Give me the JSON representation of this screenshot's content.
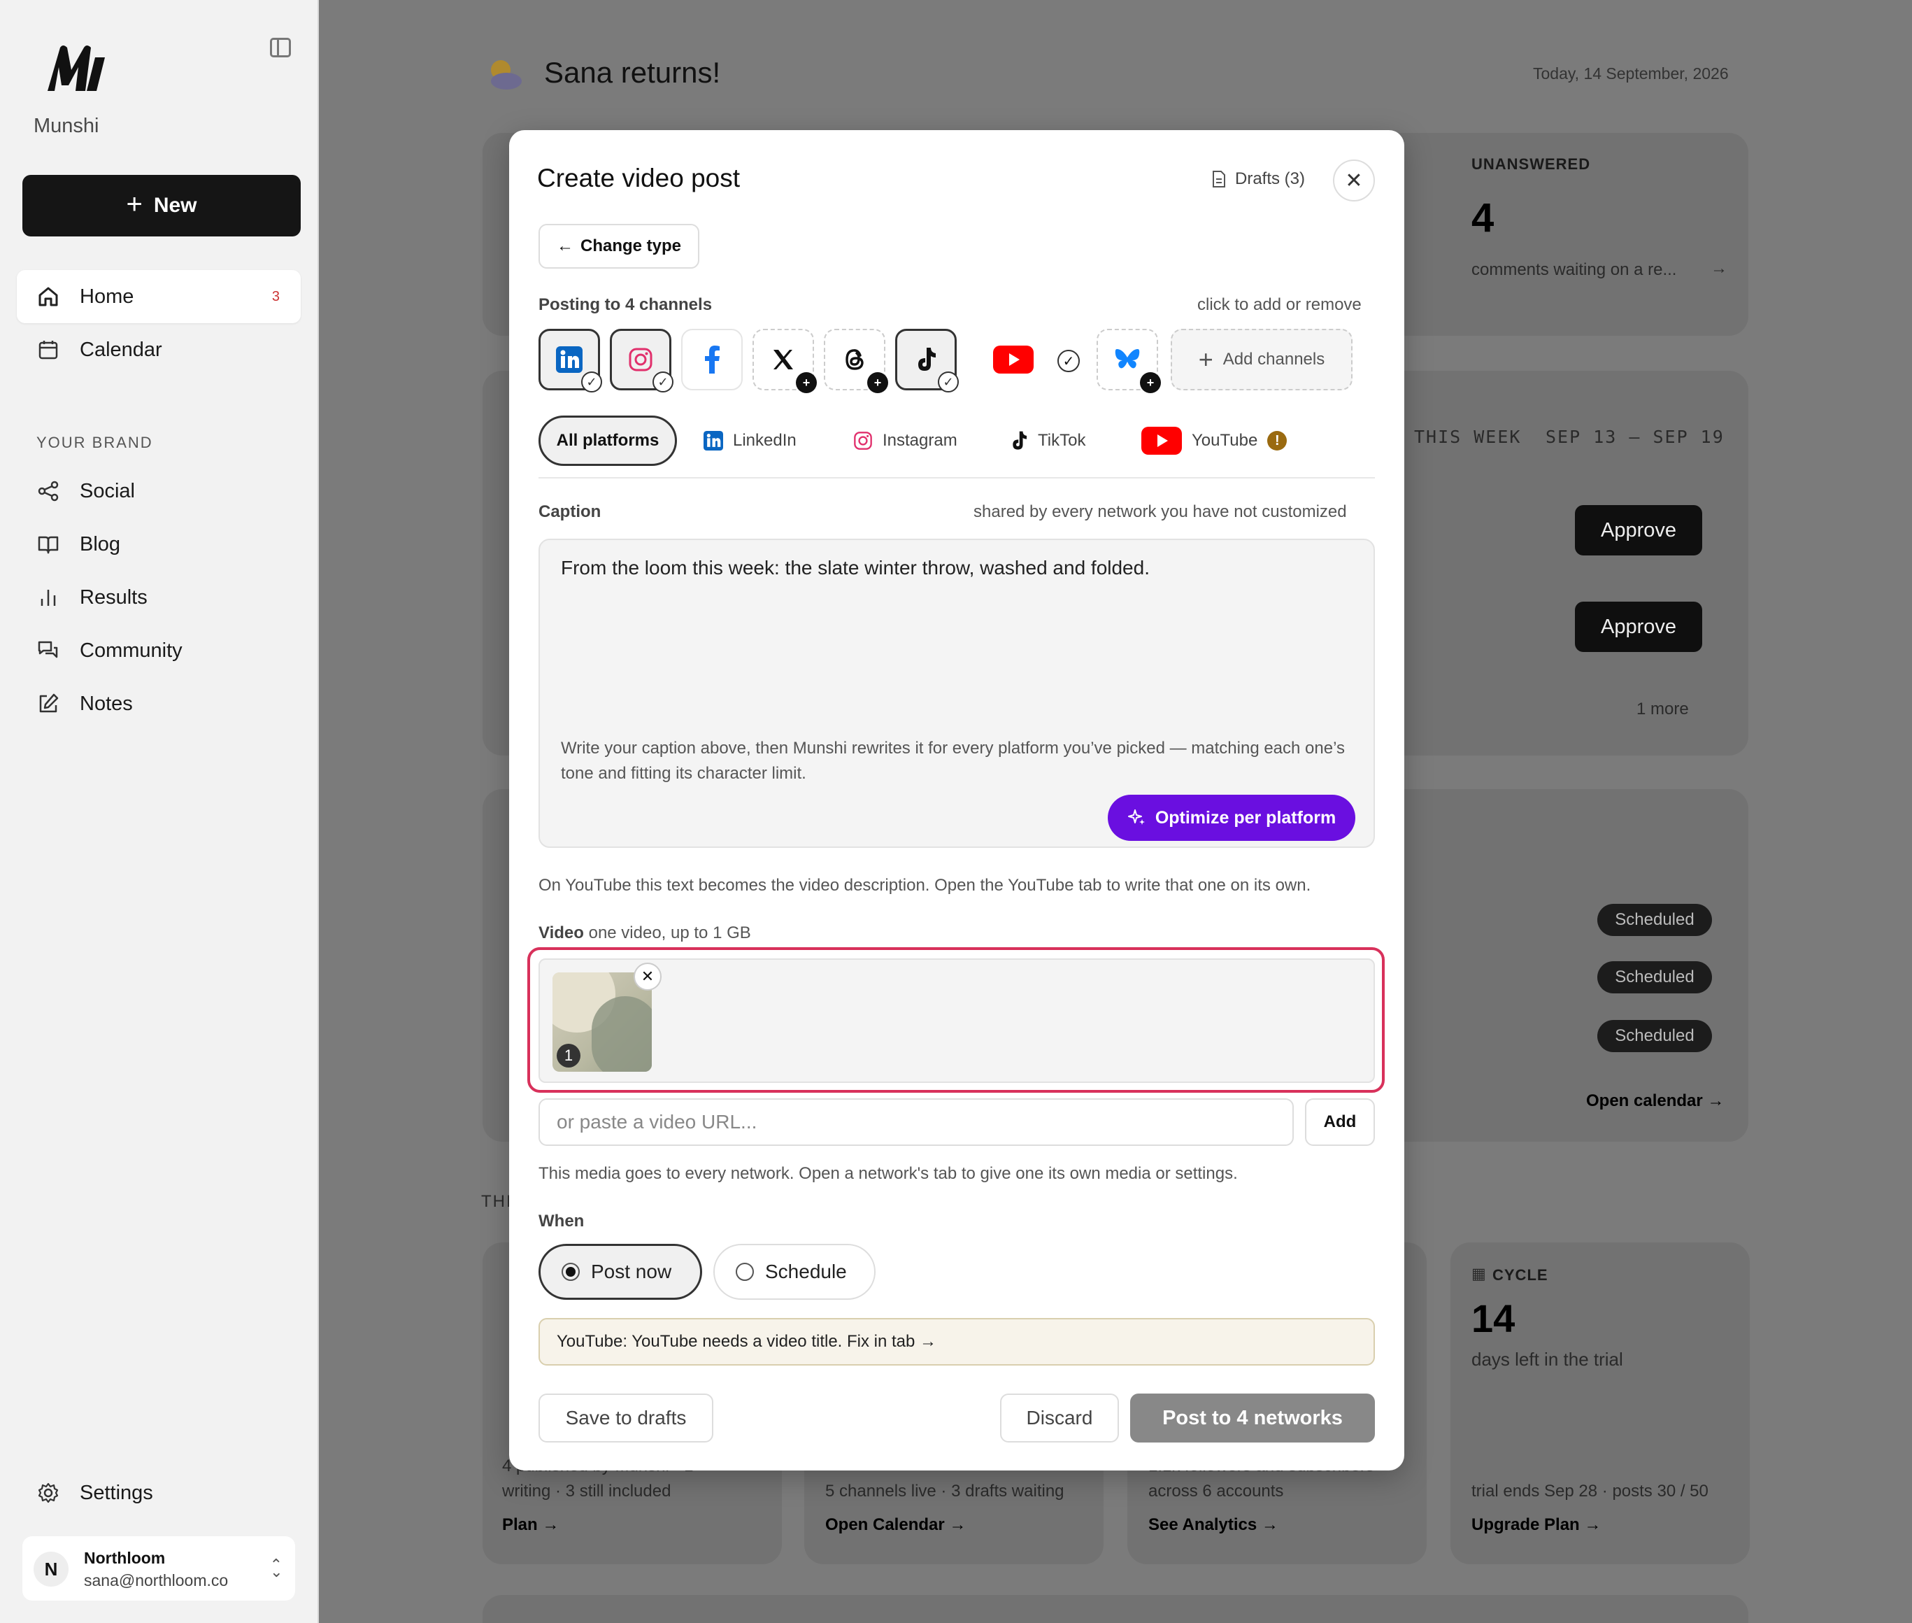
{
  "sidebar": {
    "brand": "Munshi",
    "new_label": "New",
    "nav": [
      {
        "label": "Home",
        "badge": "3"
      },
      {
        "label": "Calendar"
      }
    ],
    "section_label": "YOUR BRAND",
    "brand_nav": [
      {
        "label": "Social"
      },
      {
        "label": "Blog"
      },
      {
        "label": "Results"
      },
      {
        "label": "Community"
      },
      {
        "label": "Notes"
      }
    ],
    "settings_label": "Settings",
    "account": {
      "initial": "N",
      "name": "Northloom",
      "email": "sana@northloom.co"
    }
  },
  "main": {
    "greeting": "Sana returns!",
    "date": "Today, 14 September, 2026",
    "unanswered": {
      "label": "UNANSWERED",
      "count": "4",
      "desc": "comments waiting on a re..."
    },
    "week": {
      "label": "THIS WEEK",
      "range": "SEP 13 – SEP 19",
      "approve_label": "Approve",
      "more": "1 more"
    },
    "scheduled_label": "Scheduled",
    "open_calendar": "Open calendar →",
    "section_partial": "THI",
    "cycle": {
      "label": "CYCLE",
      "count": "14",
      "desc": "days left in the trial",
      "foot": "trial ends Sep 28 · posts 30 / 50",
      "link": "Upgrade Plan →"
    },
    "card1": {
      "foot_line1": "4 published by Munshi · 1",
      "foot_line2": "writing · 3 still included",
      "link": "Plan →"
    },
    "card2": {
      "foot": "5 channels live · 3 drafts waiting",
      "link": "Open Calendar →"
    },
    "card3": {
      "foot_line1": "1.1k followers and subscribers",
      "foot_line2": "across 6 accounts",
      "link": "See Analytics →"
    }
  },
  "modal": {
    "title": "Create video post",
    "drafts": "Drafts (3)",
    "change_type": "Change type",
    "posting_label": "Posting to 4 channels",
    "posting_hint": "click to add or remove",
    "add_channels": "Add channels",
    "platform_tabs": [
      "All platforms",
      "LinkedIn",
      "Instagram",
      "TikTok",
      "YouTube"
    ],
    "caption_label": "Caption",
    "caption_hint": "shared by every network you have not customized",
    "caption_text": "From the loom this week: the slate winter throw, washed and folded.",
    "caption_help": "Write your caption above, then Munshi rewrites it for every platform you’ve picked — matching each one’s tone and fitting its character limit.",
    "optimize_label": "Optimize per platform",
    "youtube_note": "On YouTube this text becomes the video description. Open the YouTube tab to write that one on its own.",
    "video_label": "Video",
    "video_hint": "one video, up to 1 GB",
    "video_index": "1",
    "url_placeholder": "or paste a video URL...",
    "add_label": "Add",
    "media_note": "This media goes to every network. Open a network's tab to give one its own media or settings.",
    "when_label": "When",
    "post_now": "Post now",
    "schedule": "Schedule",
    "warning": "YouTube: YouTube needs a video title. Fix in tab →",
    "save_drafts": "Save to drafts",
    "discard": "Discard",
    "post_button": "Post to 4 networks"
  },
  "colors": {
    "accent": "#6a0fe0",
    "highlight": "#d8315b",
    "linkedin": "#0a66c2",
    "instagram": "#e1306c",
    "youtube": "#ff0000",
    "bluesky": "#1185fe"
  }
}
